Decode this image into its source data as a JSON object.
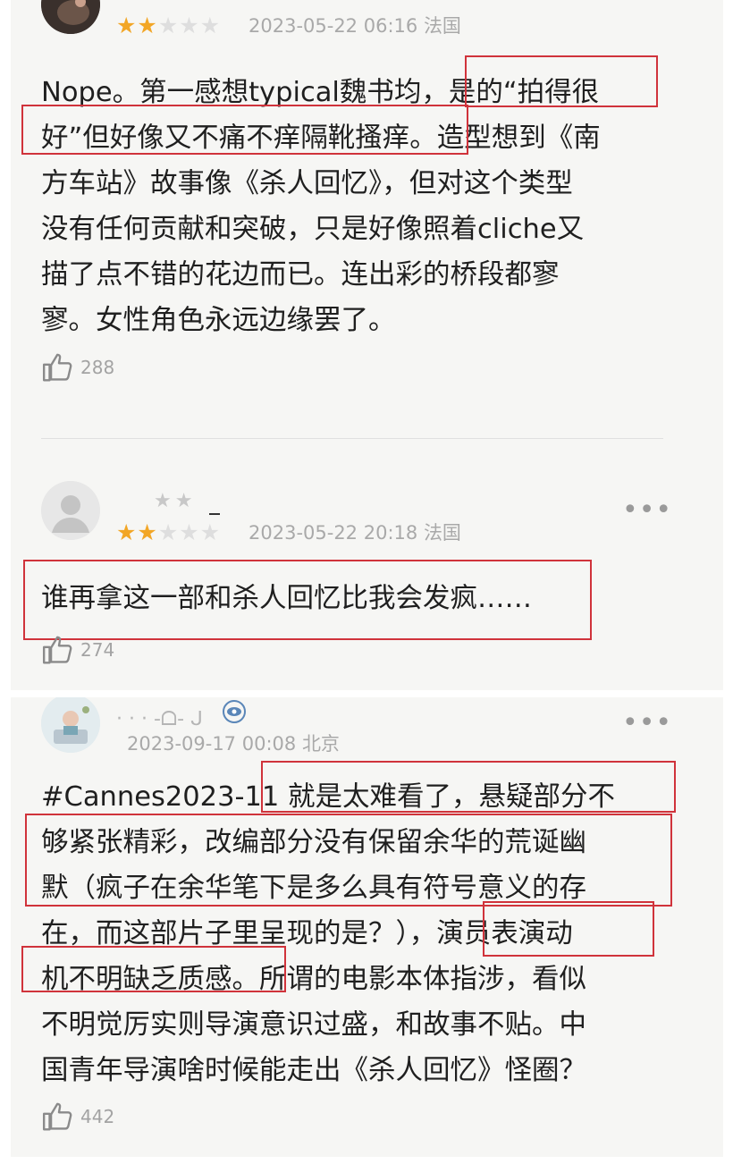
{
  "colors": {
    "card_background": "#f6f6f4",
    "star_filled": "#f2a626",
    "star_empty": "#dedede",
    "meta_text": "#a9a9a9",
    "highlight_box": "#d0333b"
  },
  "reviews": [
    {
      "rating": "2 of 5 stars",
      "stars_filled": "★★",
      "stars_empty": "★★★",
      "date": "2023-05-22 06:16",
      "location": "法国",
      "text_lines": [
        "Nope。第一感想typical魏书均，是的“拍得很",
        "好”但好像又不痛不痒隔靴搔痒。造型想到《南",
        "方车站》故事像《杀人回忆》，但对这个类型",
        "没有任何贡献和突破，只是好像照着cliche又",
        "描了点不错的花边而已。连出彩的桥段都寥",
        "寥。女性角色永远边缘罢了。"
      ],
      "likes": "288",
      "like_icon": "thumbs-up-icon"
    },
    {
      "rating": "2 of 5 stars",
      "stars_filled": "★★",
      "stars_empty": "★★★",
      "username_blurred": "★★",
      "date": "2023-05-22 20:18",
      "location": "法国",
      "text_lines": [
        "谁再拿这一部和杀人回忆比我会发疯……"
      ],
      "likes": "274",
      "like_icon": "thumbs-up-icon",
      "more_icon": "•••"
    },
    {
      "username_blurred": "· · · -ᗝ- ᒍ",
      "verified_icon": "eye-badge-icon",
      "date": "2023-09-17 00:08",
      "location": "北京",
      "text_lines": [
        "#Cannes2023-11 就是太难看了，悬疑部分不",
        "够紧张精彩，改编部分没有保留余华的荒诞幽",
        "默（疯子在余华笔下是多么具有符号意义的存",
        "在，而这部片子里呈现的是？），演员表演动",
        "机不明缺乏质感。所谓的电影本体指涉，看似",
        "不明觉厉实则导演意识过盛，和故事不贴。中",
        "国青年导演啥时候能走出《杀人回忆》怪圈？"
      ],
      "likes": "442",
      "like_icon": "thumbs-up-icon",
      "more_icon": "•••"
    }
  ]
}
